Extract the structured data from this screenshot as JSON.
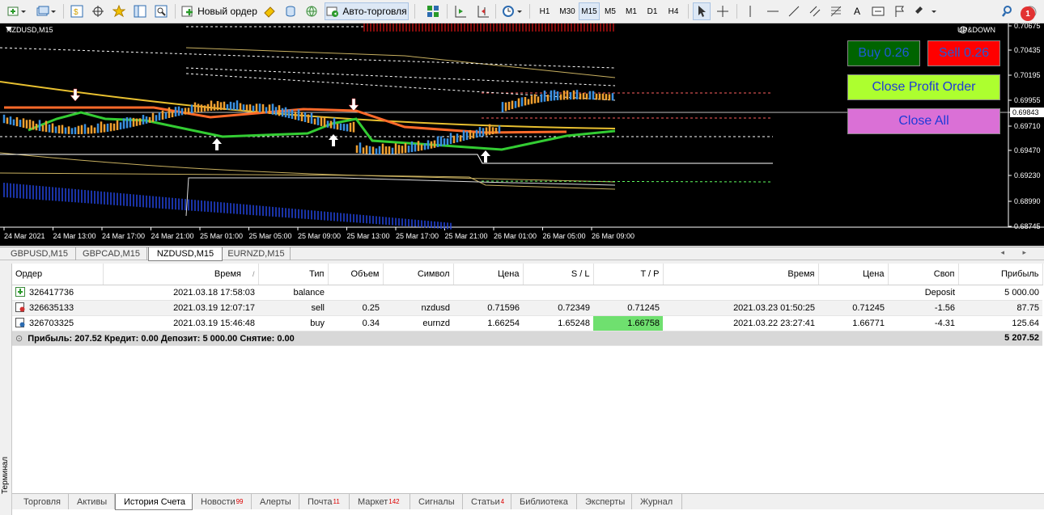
{
  "toolbar": {
    "new_order": "Новый ордер",
    "auto_trading": "Авто-торговля",
    "timeframes": [
      "H1",
      "M30",
      "M15",
      "M5",
      "M1",
      "D1",
      "H4"
    ],
    "active_timeframe": "M15",
    "notifications": "1",
    "text_tool": "A"
  },
  "chart": {
    "symbol_label": "NZDUSD,M15",
    "indicator_label": "UP&DOWN",
    "price_ticks": [
      "0.70675",
      "0.70435",
      "0.70195",
      "0.69955",
      "0.69843",
      "0.69710",
      "0.69470",
      "0.69230",
      "0.68990",
      "0.68745"
    ],
    "current_price": "0.69843",
    "time_ticks": [
      "24 Mar 2021",
      "24 Mar 13:00",
      "24 Mar 17:00",
      "24 Mar 21:00",
      "25 Mar 01:00",
      "25 Mar 05:00",
      "25 Mar 09:00",
      "25 Mar 13:00",
      "25 Mar 17:00",
      "25 Mar 21:00",
      "26 Mar 01:00",
      "26 Mar 05:00",
      "26 Mar 09:00"
    ],
    "buttons": {
      "buy": "Buy 0.26",
      "sell": "Sell 0.26",
      "close_profit": "Close Profit Order",
      "close_all": "Close All"
    },
    "colors": {
      "buy_bg": "#006400",
      "buy_text": "#1e5ad8",
      "sell_bg": "#ff0000",
      "sell_text": "#1e5ad8",
      "close_profit_bg": "#adff2f",
      "close_all_bg": "#da70d6"
    }
  },
  "chart_tabs": [
    "GBPUSD,M15",
    "GBPCAD,M15",
    "NZDUSD,M15",
    "EURNZD,M15"
  ],
  "active_chart_tab": "NZDUSD,M15",
  "history": {
    "headers": [
      "Ордер",
      "Время",
      "Тип",
      "Объем",
      "Символ",
      "Цена",
      "S / L",
      "T / P",
      "Время",
      "Цена",
      "Своп",
      "Прибыль"
    ],
    "rows": [
      {
        "order": "326417736",
        "time": "2021.03.18 17:58:03",
        "type": "balance",
        "volume": "",
        "symbol": "",
        "price": "",
        "sl": "",
        "tp": "",
        "close_time": "",
        "close_price": "",
        "swap": "Deposit",
        "profit": "5 000.00"
      },
      {
        "order": "326635133",
        "time": "2021.03.19 12:07:17",
        "type": "sell",
        "volume": "0.25",
        "symbol": "nzdusd",
        "price": "0.71596",
        "sl": "0.72349",
        "tp": "0.71245",
        "close_time": "2021.03.23 01:50:25",
        "close_price": "0.71245",
        "swap": "-1.56",
        "profit": "87.75"
      },
      {
        "order": "326703325",
        "time": "2021.03.19 15:46:48",
        "type": "buy",
        "volume": "0.34",
        "symbol": "eurnzd",
        "price": "1.66254",
        "sl": "1.65248",
        "tp": "1.66758",
        "close_time": "2021.03.22 23:27:41",
        "close_price": "1.66771",
        "swap": "-4.31",
        "profit": "125.64"
      }
    ],
    "summary": "Прибыль: 207.52  Кредит: 0.00  Депозит: 5 000.00  Снятие: 0.00",
    "summary_total": "5 207.52",
    "sort_marker": "/"
  },
  "terminal_label": "Терминал",
  "terminal_tabs": [
    {
      "label": "Торговля",
      "badge": ""
    },
    {
      "label": "Активы",
      "badge": ""
    },
    {
      "label": "История Счета",
      "badge": ""
    },
    {
      "label": "Новости",
      "badge": "99"
    },
    {
      "label": "Алерты",
      "badge": ""
    },
    {
      "label": "Почта",
      "badge": "11"
    },
    {
      "label": "Маркет",
      "badge": "142"
    },
    {
      "label": "Сигналы",
      "badge": ""
    },
    {
      "label": "Статьи",
      "badge": "4"
    },
    {
      "label": "Библиотека",
      "badge": ""
    },
    {
      "label": "Эксперты",
      "badge": ""
    },
    {
      "label": "Журнал",
      "badge": ""
    }
  ],
  "active_terminal_tab": "История Счета"
}
